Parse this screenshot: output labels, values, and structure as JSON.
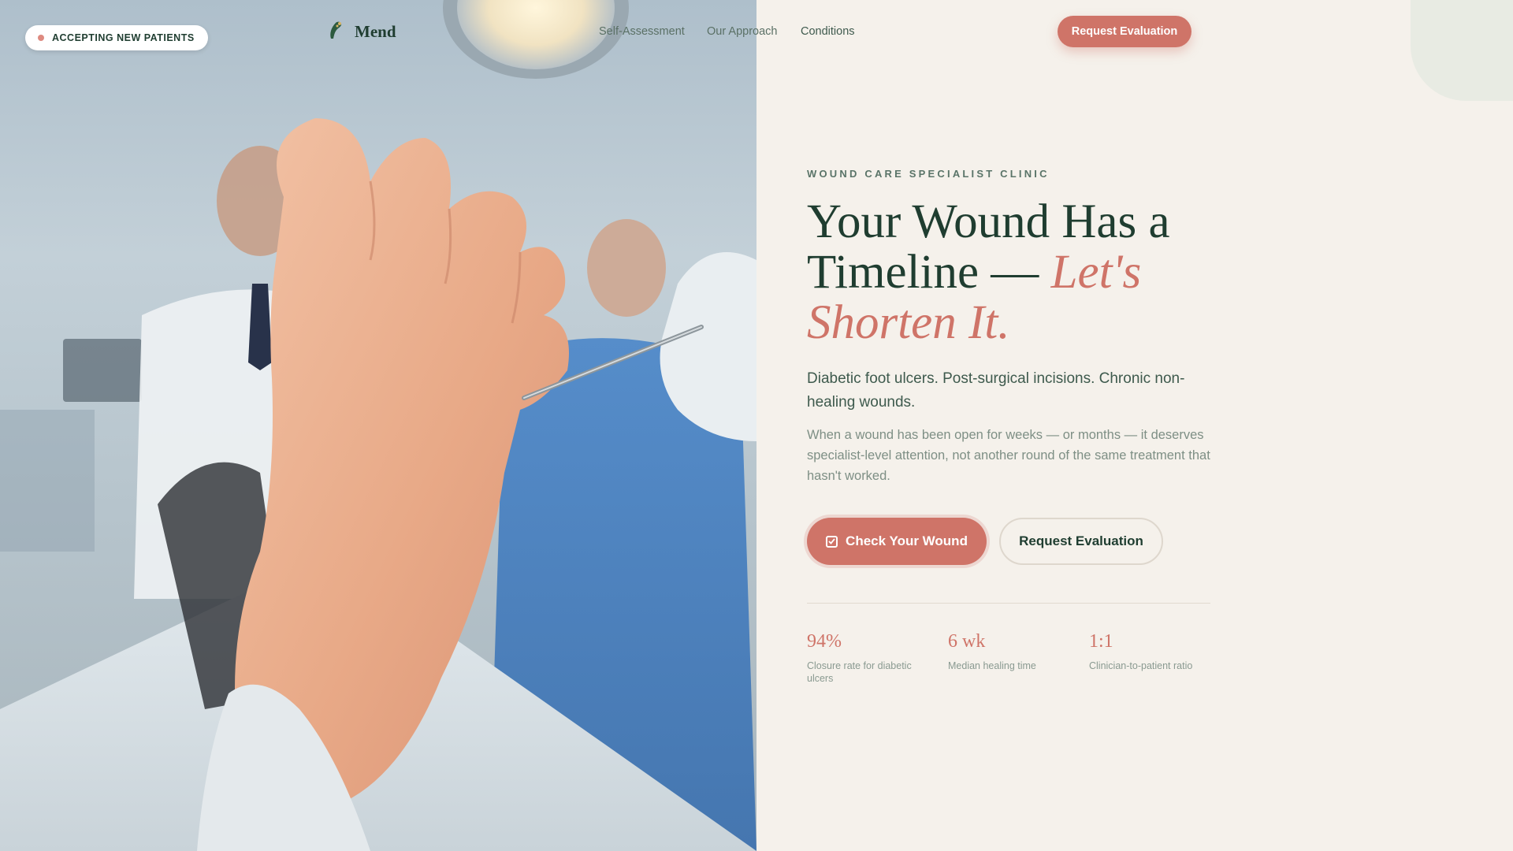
{
  "badge": {
    "text": "ACCEPTING NEW PATIENTS",
    "dot_color": "#de8a80"
  },
  "brand": {
    "name": "Mend",
    "icon": "leaf-foot-icon"
  },
  "nav": {
    "links": [
      "Self-Assessment",
      "Our Approach",
      "Conditions"
    ],
    "cta": "Request Evaluation"
  },
  "hero": {
    "eyebrow": "WOUND CARE SPECIALIST CLINIC",
    "headline_main": "Your Wound Has a Timeline — ",
    "headline_accent": "Let's Shorten It.",
    "lead": "Diabetic foot ulcers. Post-surgical incisions. Chronic non-healing wounds.",
    "body": "When a wound has been open for weeks — or months — it deserves specialist-level attention, not another round of the same treatment that hasn't worked.",
    "primary_button": "Check Your Wound",
    "secondary_button": "Request Evaluation"
  },
  "stats": [
    {
      "value": "94%",
      "label": "Closure rate for diabetic ulcers"
    },
    {
      "value": "6 wk",
      "label": "Median healing time"
    },
    {
      "value": "1:1",
      "label": "Clinician-to-patient ratio"
    }
  ],
  "colors": {
    "accent": "#cf7468",
    "brand_dark": "#1f3d30",
    "background": "#f5f1eb"
  }
}
